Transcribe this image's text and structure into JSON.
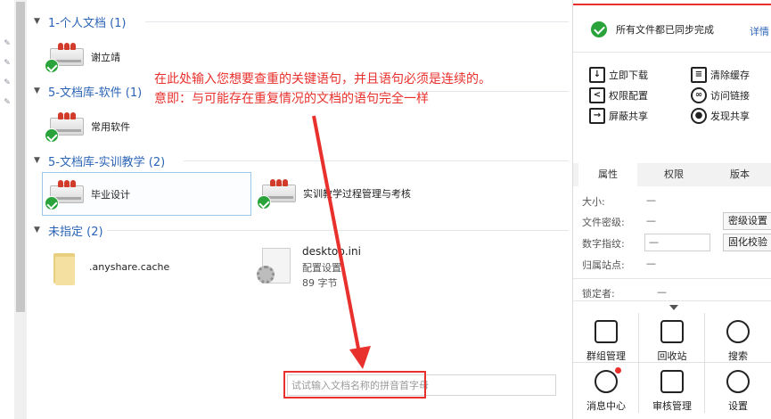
{
  "groups": [
    {
      "header": "1-个人文档 (1)",
      "items": [
        "谢立靖"
      ]
    },
    {
      "header": "5-文档库-软件 (1)",
      "items": [
        "常用软件"
      ]
    },
    {
      "header": "5-文档库-实训教学 (2)",
      "items": [
        "毕业设计",
        "实训教学过程管理与考核"
      ]
    },
    {
      "header": "未指定 (2)",
      "items": [
        ".anyshare.cache"
      ]
    }
  ],
  "desktop_file": {
    "name": "desktop.ini",
    "type": "配置设置",
    "size": "89 字节"
  },
  "annotation": {
    "line1": "在此处输入您想要查重的关键语句，并且语句必须是连续的。",
    "line2": "意即：与可能存在重复情况的文档的语句完全一样"
  },
  "search": {
    "placeholder": "试试输入文档名称的拼音首字母"
  },
  "panel": {
    "sync_status": "所有文件都已同步完成",
    "sync_detail": "详情",
    "actions": [
      "立即下载",
      "清除缓存",
      "权限配置",
      "访问链接",
      "屏蔽共享",
      "发现共享"
    ],
    "tabs": [
      "属性",
      "权限",
      "版本"
    ],
    "props": {
      "size_label": "大小:",
      "size_value": "—",
      "secret_label": "文件密级:",
      "secret_value": "—",
      "secret_btn": "密级设置",
      "digital_label": "数字指纹:",
      "digital_value": "—",
      "digital_btn": "固化校验",
      "site_label": "归属站点:",
      "site_value": "—",
      "locker_label": "锁定者:",
      "locker_value": "—"
    },
    "tools": [
      "群组管理",
      "回收站",
      "搜索",
      "消息中心",
      "审核管理",
      "设置"
    ]
  },
  "colors": {
    "accent_red": "#e8302c",
    "link_blue": "#2b64b6",
    "ok_green": "#2aa33a"
  }
}
